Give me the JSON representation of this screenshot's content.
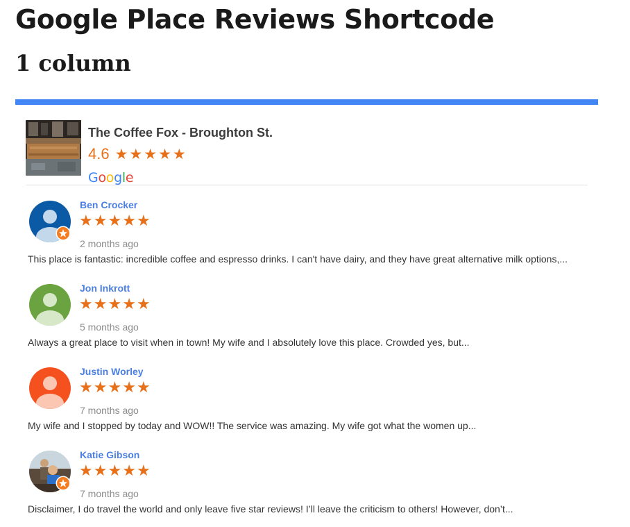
{
  "page": {
    "title": "Google Place Reviews Shortcode",
    "section_title": "1 column"
  },
  "colors": {
    "accent": "#4285f4",
    "star": "#e7711b",
    "reviewer_link": "#4a7ee0"
  },
  "place": {
    "name": "The Coffee Fox - Broughton St.",
    "rating": "4.6",
    "stars": 4.6,
    "photo": "coffee-shop-interior-photo",
    "logo": "google-logo"
  },
  "reviews": [
    {
      "name": "Ben Crocker",
      "stars": 5,
      "date": "2 months ago",
      "text": "This place is fantastic: incredible coffee and espresso drinks. I can't have dairy, and they have great alternative milk options,...",
      "avatar": "default-avatar-blue",
      "local_guide_badge": true
    },
    {
      "name": "Jon Inkrott",
      "stars": 5,
      "date": "5 months ago",
      "text": "Always a great place to visit when in town! My wife and I absolutely love this place. Crowded yes, but...",
      "avatar": "default-avatar-green",
      "local_guide_badge": false
    },
    {
      "name": "Justin Worley",
      "stars": 5,
      "date": "7 months ago",
      "text": "My wife and I stopped by today and WOW!! The service was amazing. My wife got what the women up...",
      "avatar": "default-avatar-orange",
      "local_guide_badge": false
    },
    {
      "name": "Katie Gibson",
      "stars": 5,
      "date": "7 months ago",
      "text": "Disclaimer, I do travel the world and only leave five star reviews! I’ll leave the criticism to others! However, don’t...",
      "avatar": "photo-avatar",
      "local_guide_badge": true
    }
  ]
}
